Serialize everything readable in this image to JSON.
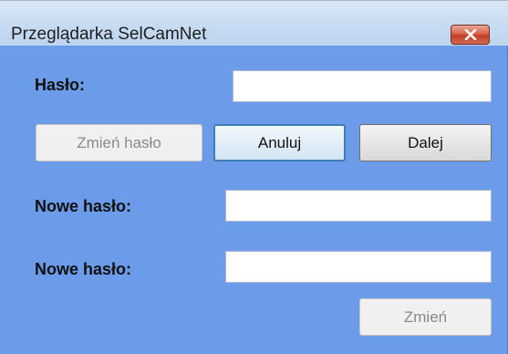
{
  "window": {
    "title": "Przeglądarka SelCamNet",
    "close_icon": "close-icon"
  },
  "form": {
    "password_label": "Hasło:",
    "password_value": "",
    "new_password_label_1": "Nowe hasło:",
    "new_password_value_1": "",
    "new_password_label_2": "Nowe hasło:",
    "new_password_value_2": ""
  },
  "buttons": {
    "change_password": "Zmień hasło",
    "cancel": "Anuluj",
    "next": "Dalej",
    "change": "Zmień"
  },
  "colors": {
    "client_background": "#6c9be9",
    "close_button": "#c43e22"
  }
}
